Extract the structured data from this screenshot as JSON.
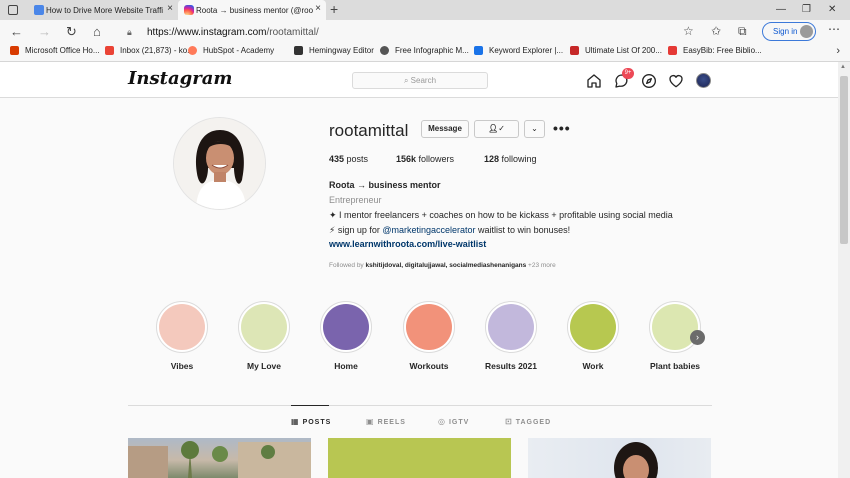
{
  "browser": {
    "tabs": [
      {
        "title": "How to Drive More Website Traffi",
        "active": false
      },
      {
        "title": "Roota → business mentor (@roo",
        "active": true
      }
    ],
    "new_tab": "+",
    "url_host": "https://www.instagram.com",
    "url_path": "/rootamittal/",
    "sign_in": "Sign in",
    "bookmarks": [
      "Microsoft Office Ho...",
      "Inbox (21,873) - ko...",
      "HubSpot - Academy",
      "Hemingway Editor",
      "Free Infographic M...",
      "Keyword Explorer |...",
      "Ultimate List Of 200...",
      "EasyBib: Free Biblio..."
    ]
  },
  "instagram": {
    "logo": "Instagram",
    "search_placeholder": "Search",
    "notification_count": "9+"
  },
  "profile": {
    "username": "rootamittal",
    "message_label": "Message",
    "follow_label": "✓",
    "chevron_label": "⌄",
    "posts_count": "435",
    "posts_label": "posts",
    "followers_count": "156k",
    "followers_label": "followers",
    "following_count": "128",
    "following_label": "following",
    "display_name": "Roota → business mentor",
    "category": "Entrepreneur",
    "bio_line1": "✦ I mentor freelancers + coaches on how to be kickass + profitable using social media",
    "bio_line2_pre": "⚡ sign up for ",
    "bio_line2_mention": "@marketingaccelerator",
    "bio_line2_post": " waitlist to win bonuses!",
    "link": "www.learnwithroota.com/live-waitlist",
    "followed_by_prefix": "Followed by ",
    "followed_by_names": "kshitijdoval, digitalujjawal, socialmediashenanigans",
    "followed_by_more": " +23 more"
  },
  "highlights": [
    {
      "label": "Vibes",
      "color": "#f4c9bd"
    },
    {
      "label": "My Love",
      "color": "#dde6b6"
    },
    {
      "label": "Home",
      "color": "#7a64ad"
    },
    {
      "label": "Workouts",
      "color": "#f2927a"
    },
    {
      "label": "Results 2021",
      "color": "#c2b8dc"
    },
    {
      "label": "Work",
      "color": "#b7c850"
    },
    {
      "label": "Plant babies",
      "color": "#dce7b1"
    }
  ],
  "profile_tabs": [
    {
      "label": "POSTS",
      "icon": "grid-icon"
    },
    {
      "label": "REELS",
      "icon": "reels-icon"
    },
    {
      "label": "IGTV",
      "icon": "igtv-icon"
    },
    {
      "label": "TAGGED",
      "icon": "tagged-icon"
    }
  ]
}
